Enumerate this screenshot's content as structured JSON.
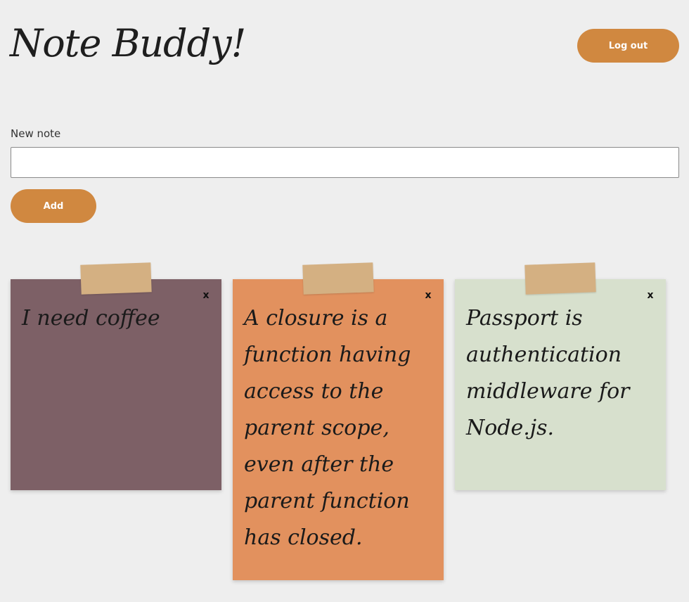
{
  "header": {
    "title": "Note Buddy!",
    "logout_label": "Log out"
  },
  "form": {
    "label": "New note",
    "input_value": "",
    "add_label": "Add"
  },
  "notes": [
    {
      "text": "I need coffee",
      "close_label": "x",
      "color": "#7d6066"
    },
    {
      "text": "A closure is a function having access to the parent scope, even after the parent function has closed.",
      "close_label": "x",
      "color": "#e2915e"
    },
    {
      "text": "Passport is authentication middleware for Node.js.",
      "close_label": "x",
      "color": "#d7e0cd"
    }
  ],
  "colors": {
    "background": "#eeeeee",
    "accent": "#d08840",
    "tape": "#d4b082"
  }
}
